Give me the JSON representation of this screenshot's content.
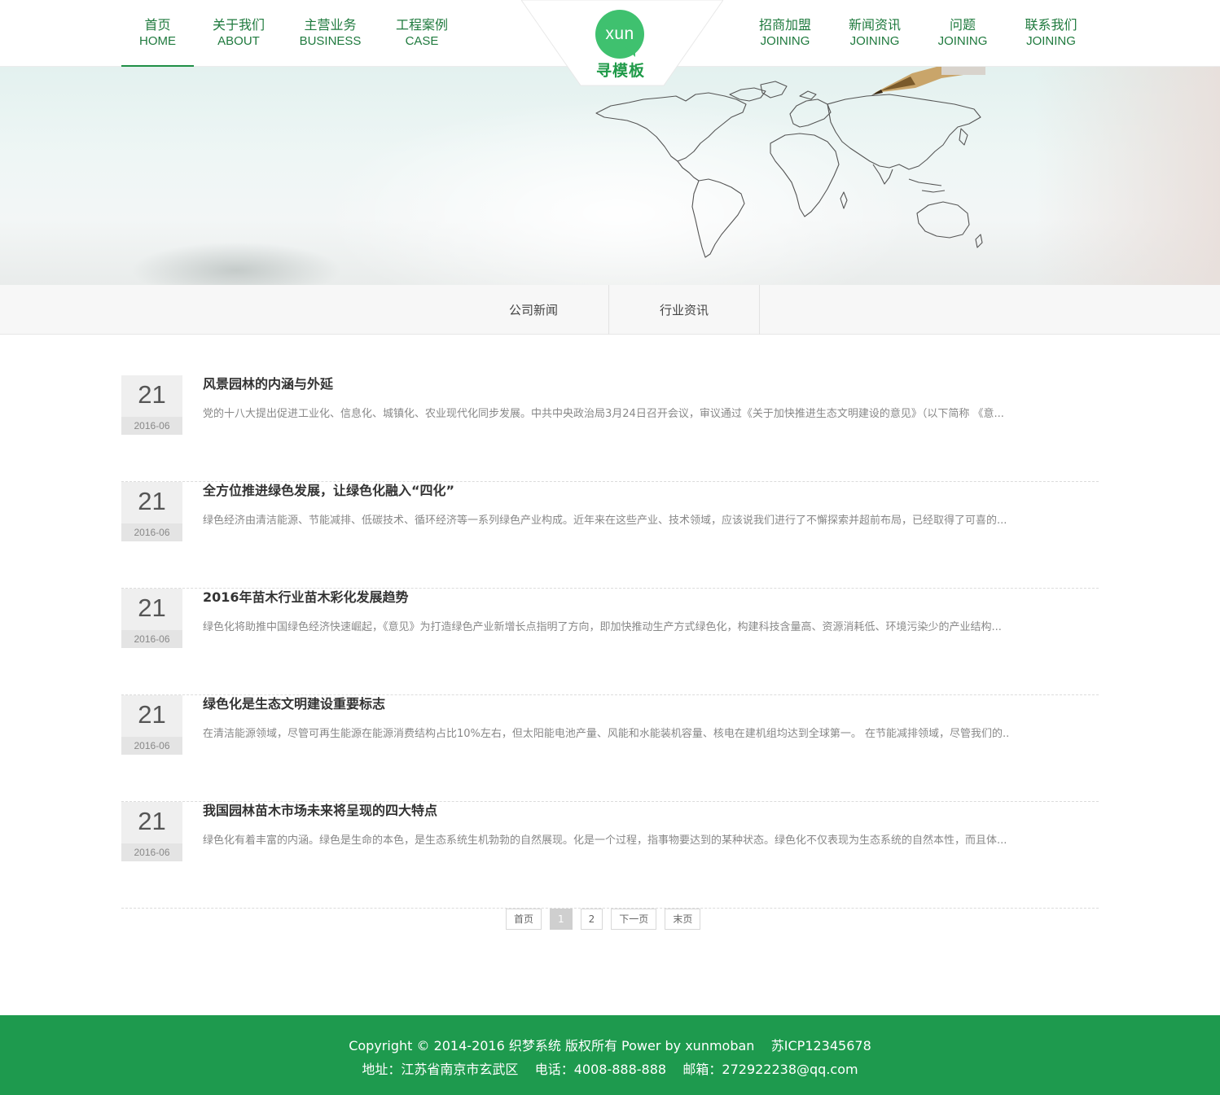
{
  "header": {
    "nav_left": [
      {
        "cn": "首页",
        "en": "HOME"
      },
      {
        "cn": "关于我们",
        "en": "ABOUT"
      },
      {
        "cn": "主营业务",
        "en": "BUSINESS"
      },
      {
        "cn": "工程案例",
        "en": "CASE"
      }
    ],
    "nav_right": [
      {
        "cn": "招商加盟",
        "en": "JOINING"
      },
      {
        "cn": "新闻资讯",
        "en": "JOINING"
      },
      {
        "cn": "问题",
        "en": "JOINING"
      },
      {
        "cn": "联系我们",
        "en": "JOINING"
      }
    ],
    "logo": {
      "mark": "xun",
      "name": "寻模板"
    },
    "active_item": "首页"
  },
  "banner": {
    "image": "world-map-pen-icon"
  },
  "subnav": {
    "tabs": [
      "公司新闻",
      "行业资讯"
    ]
  },
  "news": [
    {
      "day": "21",
      "ym": "2016-06",
      "title": "风景园林的内涵与外延",
      "summary": "党的十八大提出促进工业化、信息化、城镇化、农业现代化同步发展。中共中央政治局3月24日召开会议，审议通过《关于加快推进生态文明建设的意见》（以下简称 《意..."
    },
    {
      "day": "21",
      "ym": "2016-06",
      "title": "全方位推进绿色发展，让绿色化融入“四化”",
      "summary": "绿色经济由清洁能源、节能减排、低碳技术、循环经济等一系列绿色产业构成。近年来在这些产业、技术领域，应该说我们进行了不懈探索并超前布局，已经取得了可喜的..."
    },
    {
      "day": "21",
      "ym": "2016-06",
      "title": "2016年苗木行业苗木彩化发展趋势",
      "summary": "绿色化将助推中国绿色经济快速崛起，《意见》为打造绿色产业新增长点指明了方向，即加快推动生产方式绿色化，构建科技含量高、资源消耗低、环境污染少的产业结构..."
    },
    {
      "day": "21",
      "ym": "2016-06",
      "title": "绿色化是生态文明建设重要标志",
      "summary": "在清洁能源领域，尽管可再生能源在能源消费结构占比10%左右，但太阳能电池产量、风能和水能装机容量、核电在建机组均达到全球第一。 在节能减排领域，尽管我们的..."
    },
    {
      "day": "21",
      "ym": "2016-06",
      "title": "我国园林苗木市场未来将呈现的四大特点",
      "summary": "绿色化有着丰富的内涵。绿色是生命的本色，是生态系统生机勃勃的自然展现。化是一个过程，指事物要达到的某种状态。绿色化不仅表现为生态系统的自然本性，而且体..."
    }
  ],
  "pagination": {
    "first": "首页",
    "pages": [
      "1",
      "2"
    ],
    "current": "1",
    "next": "下一页",
    "last": "末页"
  },
  "footer": {
    "line1": "Copyright © 2014-2016 织梦系统 版权所有 Power by xunmoban    苏ICP12345678",
    "line2": "地址：江苏省南京市玄武区    电话：4008-888-888    邮箱：272922238@qq.com"
  },
  "colors": {
    "brand_green": "#1e9a4e",
    "logo_green": "#3fc16f",
    "nav_text": "#1f7a3e"
  }
}
